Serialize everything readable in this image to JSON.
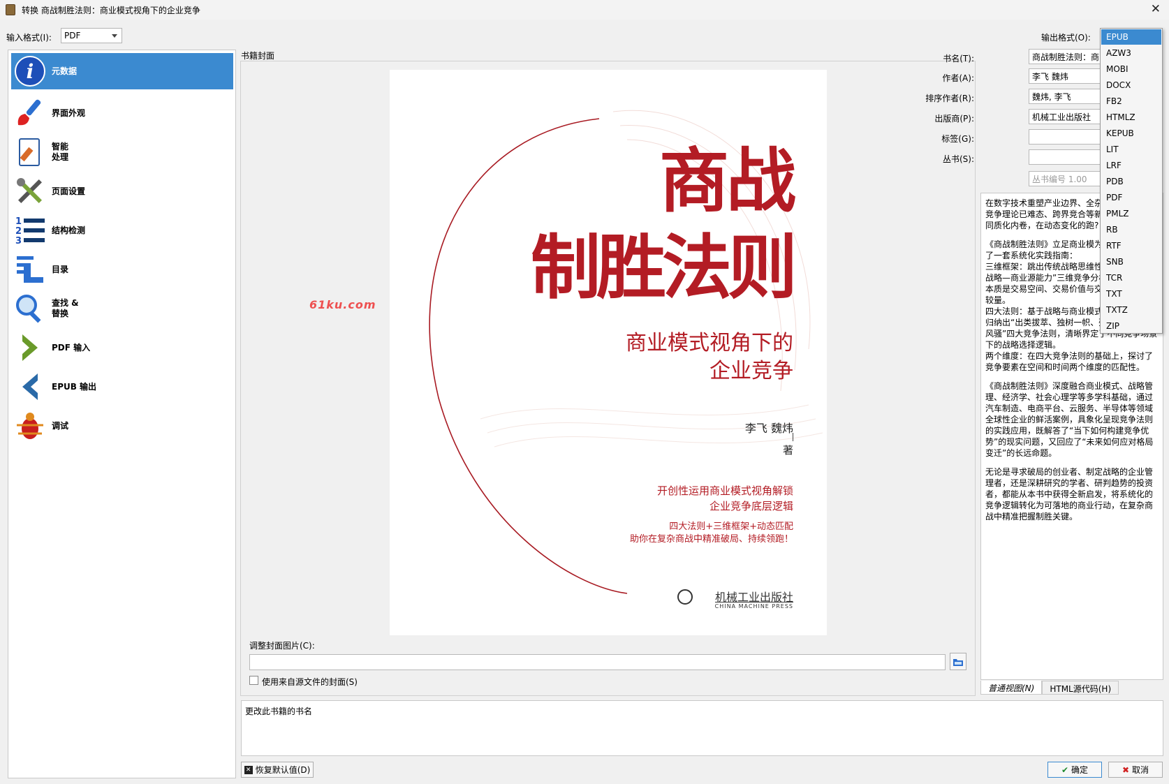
{
  "window": {
    "title": "转换 商战制胜法则：商业模式视角下的企业竞争",
    "close_icon": "close-icon"
  },
  "input_format": {
    "label": "输入格式(I):",
    "value": "PDF"
  },
  "output_format": {
    "label": "输出格式(O):",
    "value": "EPUB"
  },
  "sidebar": {
    "items": [
      {
        "label": "元数据",
        "icon": "info-icon"
      },
      {
        "label": "界面外观",
        "icon": "paintbrush-icon"
      },
      {
        "label": "智能\n处理",
        "icon": "heuristics-icon"
      },
      {
        "label": "页面设置",
        "icon": "tools-icon"
      },
      {
        "label": "结构检测",
        "icon": "numbered-list-icon"
      },
      {
        "label": "目录",
        "icon": "toc-icon"
      },
      {
        "label": "查找 &\n替换",
        "icon": "magnifier-icon"
      },
      {
        "label": "PDF 输入",
        "icon": "arrow-right-icon"
      },
      {
        "label": "EPUB 输出",
        "icon": "arrow-left-icon"
      },
      {
        "label": "调试",
        "icon": "bug-icon"
      }
    ]
  },
  "cover": {
    "group_label": "书籍封面",
    "title_line1": "商战",
    "title_line2": "制胜法则",
    "subtitle_line1": "商业模式视角下的",
    "subtitle_line2": "企业竞争",
    "authors": "李飞  魏炜",
    "role": "著",
    "tagline1_line1": "开创性运用商业模式视角解锁",
    "tagline1_line2": "企业竞争底层逻辑",
    "tagline2_line1": "四大法则+三维框架+动态匹配",
    "tagline2_line2": "助你在复杂商战中精准破局、持续领跑！",
    "publisher": "机械工业出版社",
    "publisher_en": "CHINA MACHINE PRESS",
    "watermark": "61ku.com",
    "resize_label": "调整封面图片(C):",
    "resize_value": "",
    "use_source_label": "使用来自源文件的封面(S)"
  },
  "metadata": {
    "title_label": "书名(T):",
    "title_value": "商战制胜法则：商",
    "author_label": "作者(A):",
    "author_value": "李飞 魏炜",
    "author_sort_label": "排序作者(R):",
    "author_sort_value": "魏炜, 李飞",
    "publisher_label": "出版商(P):",
    "publisher_value": "机械工业出版社",
    "tags_label": "标签(G):",
    "tags_value": "",
    "series_label": "丛书(S):",
    "series_value": "",
    "series_index_placeholder": "丛书编号 1.00"
  },
  "comments": {
    "paragraphs": [
      "在数字技术重塑产业边界、全杂的当下，传统竞争理论已难态、跨界竞合等新型商业现象破同质化内卷，在动态变化的跑?",
      "《商战制胜法则》立足商业模为企业竞争提供了一套系统化实践指南：\n三维框架：跳出传统战略思维性地构建了“竞争战略—商业源能力”三维竞争分析框架，揭争的本质是交易空间、交易价值与交易效率的综合较量。\n四大法则：基于战略与商业模式的组合差异，归纳出“出类拔萃、独树一帜、殊途同归、各领风骚”四大竞争法则，清晰界定了不同竞争场景下的战略选择逻辑。\n两个维度：在四大竞争法则的基础上，探讨了竞争要素在空间和时间两个维度的匹配性。",
      "《商战制胜法则》深度融合商业模式、战略管理、经济学、社会心理学等多学科基础，通过汽车制造、电商平台、云服务、半导体等领域全球性企业的鲜活案例，具象化呈现竞争法则的实践应用，既解答了“当下如何构建竞争优势”的现实问题，又回应了“未来如何应对格局变迁”的长远命题。",
      "无论是寻求破局的创业者、制定战略的企业管理者，还是深耕研究的学者、研判趋势的投资者，都能从本书中获得全新启发，将系统化的竞争逻辑转化为可落地的商业行动，在复杂商战中精准把握制胜关键。"
    ]
  },
  "view_tabs": {
    "normal": "普通视图(N)",
    "html": "HTML源代码(H)"
  },
  "help_text": "更改此书籍的书名",
  "buttons": {
    "restore": "恢复默认值(D)",
    "ok": "确定",
    "cancel": "取消"
  },
  "format_options": [
    "EPUB",
    "AZW3",
    "MOBI",
    "DOCX",
    "FB2",
    "HTMLZ",
    "KEPUB",
    "LIT",
    "LRF",
    "PDB",
    "PDF",
    "PMLZ",
    "RB",
    "RTF",
    "SNB",
    "TCR",
    "TXT",
    "TXTZ",
    "ZIP"
  ],
  "colors": {
    "accent": "#3b8ad0",
    "cover_red": "#b31c24"
  }
}
